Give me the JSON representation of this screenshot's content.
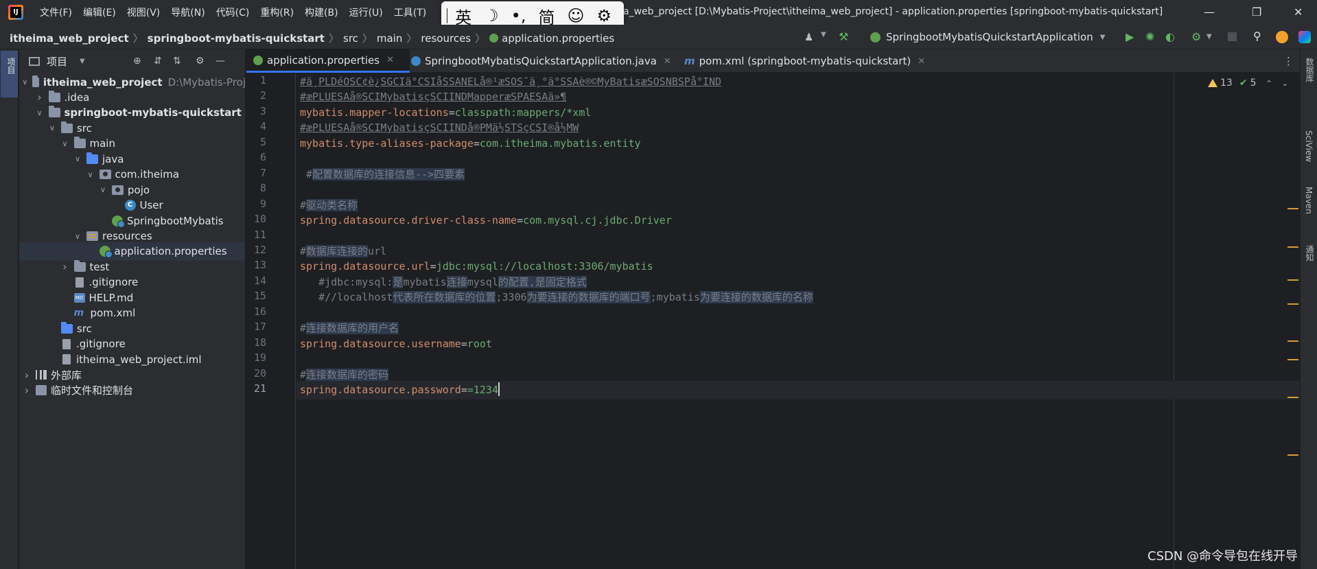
{
  "menu": {
    "items": [
      "文件(F)",
      "编辑(E)",
      "视图(V)",
      "导航(N)",
      "代码(C)",
      "重构(R)",
      "构建(B)",
      "运行(U)",
      "工具(T)"
    ]
  },
  "window": {
    "title": "a_web_project [D:\\Mybatis-Project\\itheima_web_project] - application.properties [springboot-mybatis-quickstart]"
  },
  "ime": {
    "lang": "英",
    "moon": "☽",
    "punct": "•,",
    "simp": "简",
    "emoji": "☺",
    "gear": "⚙"
  },
  "breadcrumb": {
    "items": [
      "itheima_web_project",
      "springboot-mybatis-quickstart",
      "src",
      "main",
      "resources",
      "application.properties"
    ]
  },
  "toolbar": {
    "run_config": "SpringbootMybatisQuickstartApplication"
  },
  "left_strip": {
    "label": "项目"
  },
  "project_panel": {
    "title": "项目",
    "tree": [
      {
        "label": "itheima_web_project",
        "hint": "D:\\Mybatis-Proj",
        "indent": 0,
        "arrow": "open",
        "icon": "folder",
        "bold": true
      },
      {
        "label": ".idea",
        "indent": 1,
        "arrow": "closed",
        "icon": "folder"
      },
      {
        "label": "springboot-mybatis-quickstart",
        "indent": 1,
        "arrow": "open",
        "icon": "folder",
        "bold": true
      },
      {
        "label": "src",
        "indent": 2,
        "arrow": "open",
        "icon": "folder"
      },
      {
        "label": "main",
        "indent": 3,
        "arrow": "open",
        "icon": "folder"
      },
      {
        "label": "java",
        "indent": 4,
        "arrow": "open",
        "icon": "folder-blue"
      },
      {
        "label": "com.itheima",
        "indent": 5,
        "arrow": "open",
        "icon": "package"
      },
      {
        "label": "pojo",
        "indent": 6,
        "arrow": "open",
        "icon": "package"
      },
      {
        "label": "User",
        "indent": 7,
        "arrow": "none",
        "icon": "class"
      },
      {
        "label": "SpringbootMybatis",
        "indent": 6,
        "arrow": "none",
        "icon": "spring"
      },
      {
        "label": "resources",
        "indent": 4,
        "arrow": "open",
        "icon": "res"
      },
      {
        "label": "application.properties",
        "indent": 5,
        "arrow": "none",
        "icon": "spring",
        "selected": true
      },
      {
        "label": "test",
        "indent": 3,
        "arrow": "closed",
        "icon": "folder"
      },
      {
        "label": ".gitignore",
        "indent": 3,
        "arrow": "none",
        "icon": "file"
      },
      {
        "label": "HELP.md",
        "indent": 3,
        "arrow": "none",
        "icon": "md"
      },
      {
        "label": "pom.xml",
        "indent": 3,
        "arrow": "none",
        "icon": "maven"
      },
      {
        "label": "src",
        "indent": 2,
        "arrow": "none",
        "icon": "folder-blue"
      },
      {
        "label": ".gitignore",
        "indent": 2,
        "arrow": "none",
        "icon": "file"
      },
      {
        "label": "itheima_web_project.iml",
        "indent": 2,
        "arrow": "none",
        "icon": "iml"
      },
      {
        "label": "外部库",
        "indent": 0,
        "arrow": "closed",
        "icon": "lib"
      },
      {
        "label": "临时文件和控制台",
        "indent": 0,
        "arrow": "closed",
        "icon": "scratch"
      }
    ]
  },
  "tabs": [
    {
      "label": "application.properties",
      "active": true
    },
    {
      "label": "SpringbootMybatisQuickstartApplication.java",
      "active": false
    },
    {
      "label": "pom.xml (springboot-mybatis-quickstart)",
      "active": false
    }
  ],
  "inspection": {
    "warnings": "13",
    "ok": "5"
  },
  "code_lines": [
    {
      "n": "1",
      "parts": [
        {
          "t": "#ä¸PLDéOSC¢è¿SGCIä°CSIåSSANELå®¹æSOS¯ä¸°ä°SSAè®©MyBatisæSOSNBSPå°IND",
          "c": "c-garb"
        }
      ]
    },
    {
      "n": "2",
      "parts": [
        {
          "t": "#æPLUESAå®SCIMybatisçSCIINDMapperæSPAESAä»¶",
          "c": "c-garb"
        }
      ]
    },
    {
      "n": "3",
      "parts": [
        {
          "t": "mybatis.mapper-locations",
          "c": "c-key"
        },
        {
          "t": "=",
          "c": "c-eq"
        },
        {
          "t": "classpath:mappers/*xml",
          "c": "c-val"
        }
      ]
    },
    {
      "n": "4",
      "parts": [
        {
          "t": "#æPLUESAå®SCIMybatisçSCIINDå®PMä½STSçCSI®å½MW",
          "c": "c-garb"
        }
      ]
    },
    {
      "n": "5",
      "parts": [
        {
          "t": "mybatis.type-aliases-package",
          "c": "c-key"
        },
        {
          "t": "=",
          "c": "c-eq"
        },
        {
          "t": "com.itheima.mybatis.entity",
          "c": "c-val"
        }
      ]
    },
    {
      "n": "6",
      "parts": []
    },
    {
      "n": "7",
      "parts": [
        {
          "t": " #",
          "c": "c-com"
        },
        {
          "t": "配置数据库的连接信息-->四要素",
          "c": "c-com-hl"
        }
      ]
    },
    {
      "n": "8",
      "parts": []
    },
    {
      "n": "9",
      "parts": [
        {
          "t": "#",
          "c": "c-com"
        },
        {
          "t": "驱动类名称",
          "c": "c-com-hl"
        }
      ]
    },
    {
      "n": "10",
      "parts": [
        {
          "t": "spring.datasource.driver-class-name",
          "c": "c-key"
        },
        {
          "t": "=",
          "c": "c-eq"
        },
        {
          "t": "com.mysql.cj.jdbc.Driver",
          "c": "c-val"
        }
      ]
    },
    {
      "n": "11",
      "parts": []
    },
    {
      "n": "12",
      "parts": [
        {
          "t": "#",
          "c": "c-com"
        },
        {
          "t": "数据库连接的",
          "c": "c-com-hl"
        },
        {
          "t": "url",
          "c": "c-com"
        }
      ]
    },
    {
      "n": "13",
      "parts": [
        {
          "t": "spring.datasource.url",
          "c": "c-key"
        },
        {
          "t": "=",
          "c": "c-eq"
        },
        {
          "t": "jdbc:mysql://localhost:3306/mybatis",
          "c": "c-val"
        }
      ]
    },
    {
      "n": "14",
      "parts": [
        {
          "t": "   #jdbc:mysql:",
          "c": "c-com"
        },
        {
          "t": "是",
          "c": "c-com-hl"
        },
        {
          "t": "mybatis",
          "c": "c-com"
        },
        {
          "t": "连接",
          "c": "c-com-hl"
        },
        {
          "t": "mysql",
          "c": "c-com"
        },
        {
          "t": "的配置,是固定格式",
          "c": "c-com-hl"
        }
      ]
    },
    {
      "n": "15",
      "parts": [
        {
          "t": "   #//localhost",
          "c": "c-com"
        },
        {
          "t": "代表所在数据库的位置",
          "c": "c-com-hl"
        },
        {
          "t": ";3306",
          "c": "c-com"
        },
        {
          "t": "为要连接的数据库的端口号",
          "c": "c-com-hl"
        },
        {
          "t": ";mybatis",
          "c": "c-com"
        },
        {
          "t": "为要连接的数据库的名称",
          "c": "c-com-hl"
        }
      ]
    },
    {
      "n": "16",
      "parts": []
    },
    {
      "n": "17",
      "parts": [
        {
          "t": "#",
          "c": "c-com"
        },
        {
          "t": "连接数据库的用户名",
          "c": "c-com-hl"
        }
      ]
    },
    {
      "n": "18",
      "parts": [
        {
          "t": "spring.datasource.username",
          "c": "c-key"
        },
        {
          "t": "=",
          "c": "c-eq"
        },
        {
          "t": "root",
          "c": "c-val"
        }
      ]
    },
    {
      "n": "19",
      "parts": []
    },
    {
      "n": "20",
      "parts": [
        {
          "t": "#",
          "c": "c-com"
        },
        {
          "t": "连接数据库的密码",
          "c": "c-com-hl"
        }
      ]
    },
    {
      "n": "21",
      "parts": [
        {
          "t": "spring.datasource.password",
          "c": "c-key"
        },
        {
          "t": "=",
          "c": "c-eq"
        },
        {
          "t": "=1234",
          "c": "c-val"
        }
      ],
      "current": true
    }
  ],
  "right_strip": {
    "labels": [
      "数据库",
      "SciView",
      "Maven",
      "通知"
    ]
  },
  "watermark": "CSDN @命令导包在线开导",
  "colors": {
    "accent": "#3574f0",
    "key": "#cf8e6d",
    "value": "#6aab73",
    "comment": "#7a7e85",
    "warning": "#f2c55c"
  }
}
